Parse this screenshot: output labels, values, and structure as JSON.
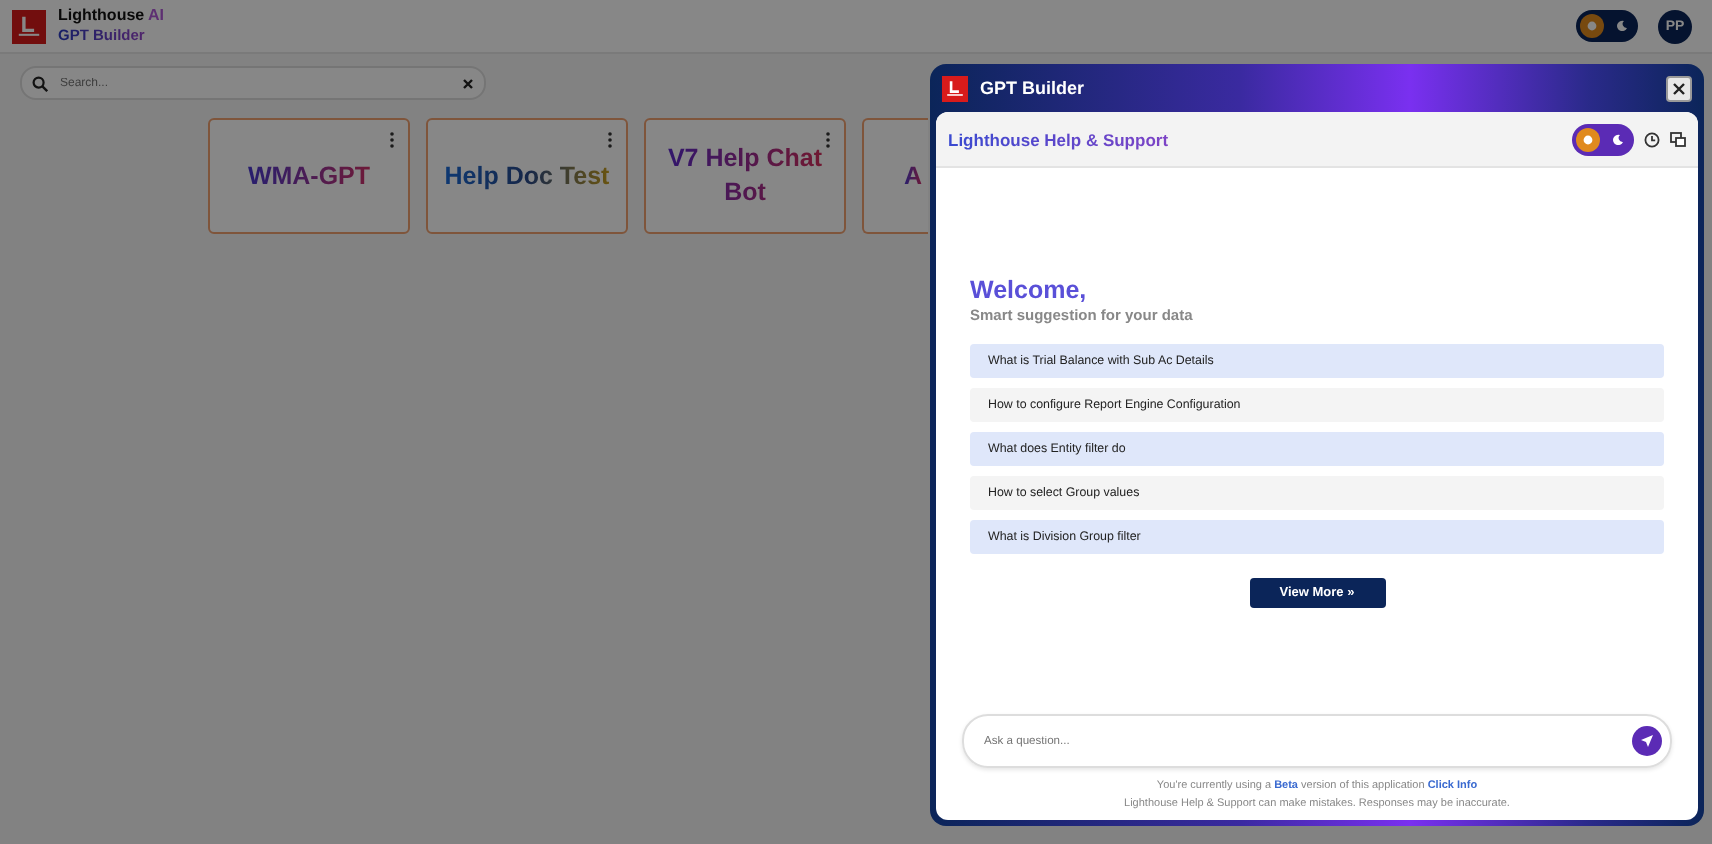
{
  "header": {
    "brand": "Lighthouse",
    "brand_suffix": "AI",
    "subtitle": "GPT Builder",
    "theme_toggle": [
      {
        "kind": "sun",
        "selected": true
      },
      {
        "kind": "moon",
        "selected": false
      }
    ],
    "avatar": "PP"
  },
  "search": {
    "placeholder": "Search..."
  },
  "cards": [
    {
      "title": "WMA-GPT"
    },
    {
      "title": "Help Doc Test"
    },
    {
      "title": "V7 Help Chat Bot"
    },
    {
      "title": "A",
      "kind": "partial"
    }
  ],
  "panel": {
    "title": "GPT Builder",
    "assistant": "Lighthouse Help & Support",
    "theme_toggle": [
      {
        "kind": "sun",
        "selected": true
      },
      {
        "kind": "moon",
        "selected": false
      }
    ],
    "welcome": "Welcome,",
    "tagline": "Smart suggestion for your data",
    "suggestions": [
      "What is Trial Balance with Sub Ac Details",
      "How to configure Report Engine Configuration",
      "What does Entity filter do",
      "How to select Group values",
      "What is Division Group filter"
    ],
    "view_more": "View More",
    "view_more_icon": "»",
    "input": {
      "placeholder": "Ask a question..."
    },
    "notice": {
      "before": "You're currently using a",
      "badge": "Beta",
      "after": "version of this application",
      "link": "Click Info"
    },
    "disclaimer": "Lighthouse Help & Support can make mistakes. Responses may be inaccurate."
  }
}
